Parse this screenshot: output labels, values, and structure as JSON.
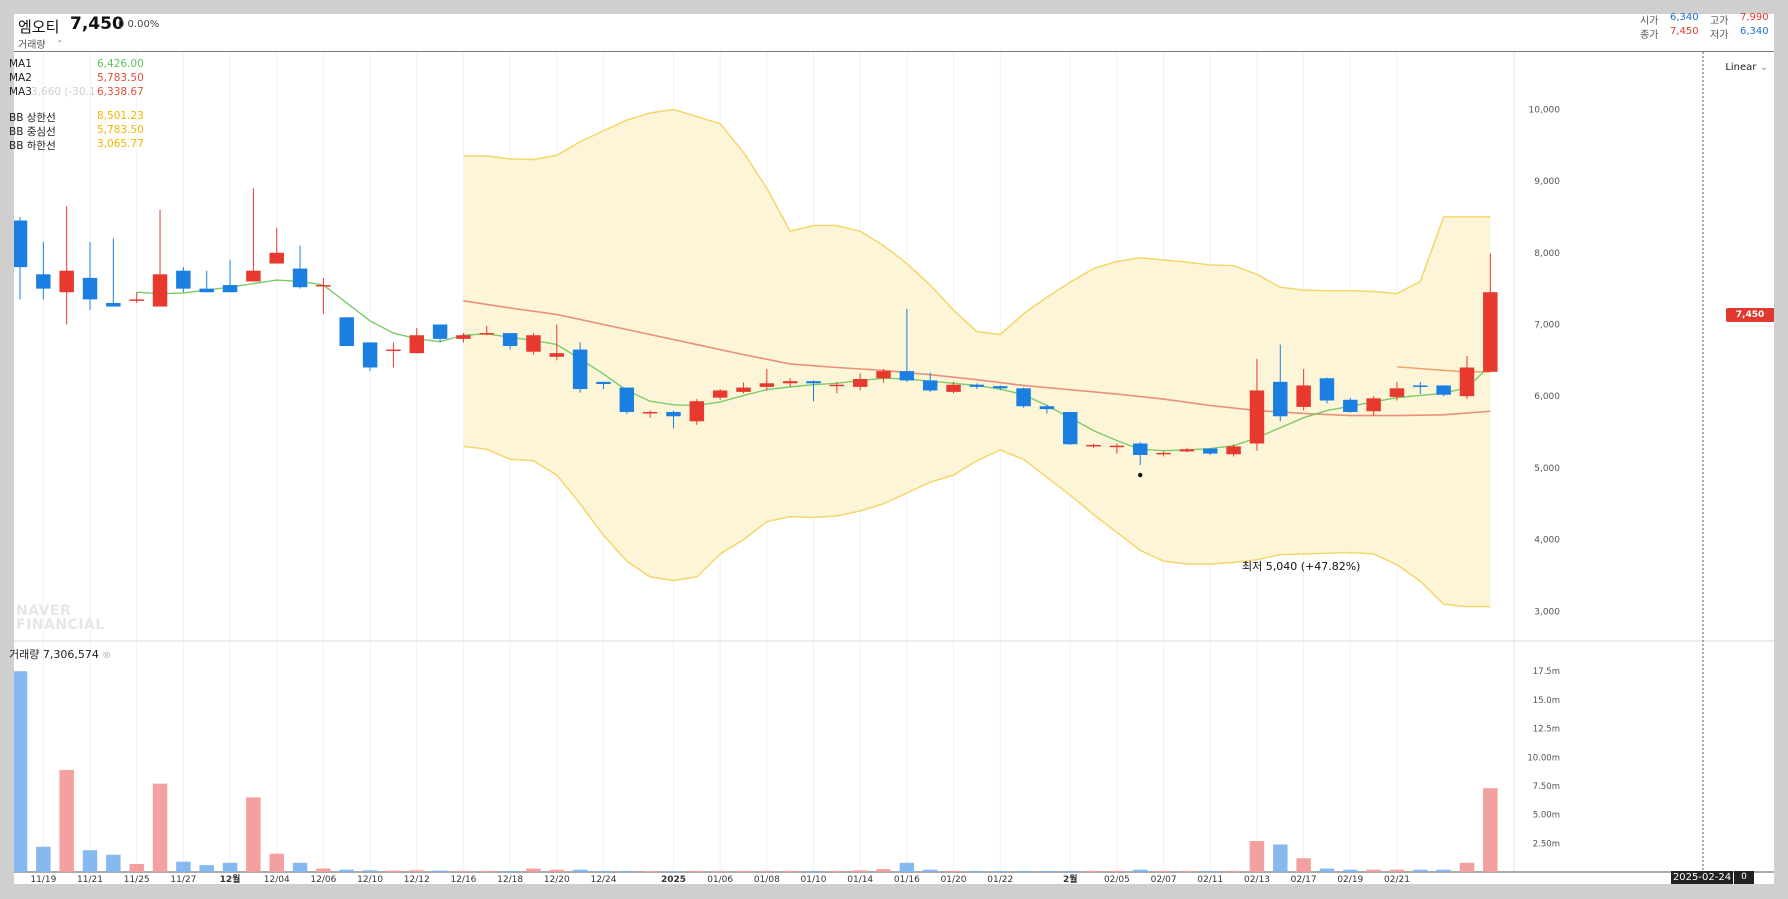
{
  "header": {
    "name": "엠오티",
    "price": "7,450",
    "change": "0 0.00%",
    "volume_label": "거래량",
    "volume_value": "-",
    "open_label": "시가",
    "open": "6,340",
    "high_label": "고가",
    "high": "7,990",
    "close_label": "종가",
    "close": "7,450",
    "low_label": "저가",
    "low": "6,340"
  },
  "legend": [
    {
      "name": "MA1",
      "value": "6,426.00",
      "color": "#5fbf5f"
    },
    {
      "name": "MA2",
      "value": "5,783.50",
      "color": "#e0503a"
    },
    {
      "name": "MA3",
      "value": "6,338.67",
      "color": "#e0503a"
    },
    {
      "name": "BB 상한선",
      "value": "8,501.23",
      "color": "#f0b400"
    },
    {
      "name": "BB 중심선",
      "value": "5,783.50",
      "color": "#f0b400"
    },
    {
      "name": "BB 하한선",
      "value": "3,065.77",
      "color": "#f0b400"
    }
  ],
  "legend_extra": "3,660 (-30.11%)",
  "scale_button": "Linear",
  "current_price_tag": "7,450",
  "volume_title": "거래량 7,306,574",
  "watermark": [
    "NAVER",
    "FINANCIAL"
  ],
  "min_label": "최저 5,040 (+47.82%)",
  "date_tag": "2025-02-24",
  "volume_tag": "0",
  "colors": {
    "up": "#e8392e",
    "down": "#1a7fe0",
    "band": "#fdf5d8",
    "band_edge": "#f5d66a"
  },
  "chart_data": {
    "type": "candlestick",
    "price_axis": [
      "10,000",
      "9,000",
      "8,000",
      "7,000",
      "6,000",
      "5,000",
      "4,000",
      "3,000"
    ],
    "price_ylim": [
      2600,
      10800
    ],
    "volume_axis": [
      "17.5m",
      "15.0m",
      "12.5m",
      "10.00m",
      "7.50m",
      "5.00m",
      "2.50m"
    ],
    "volume_ylim": [
      0,
      19000000
    ],
    "x_labels": [
      {
        "i": 1,
        "text": "11/19"
      },
      {
        "i": 3,
        "text": "11/21"
      },
      {
        "i": 5,
        "text": "11/25"
      },
      {
        "i": 7,
        "text": "11/27"
      },
      {
        "i": 9,
        "text": "12월",
        "bold": true
      },
      {
        "i": 11,
        "text": "12/04"
      },
      {
        "i": 13,
        "text": "12/06"
      },
      {
        "i": 15,
        "text": "12/10"
      },
      {
        "i": 17,
        "text": "12/12"
      },
      {
        "i": 19,
        "text": "12/16"
      },
      {
        "i": 21,
        "text": "12/18"
      },
      {
        "i": 23,
        "text": "12/20"
      },
      {
        "i": 25,
        "text": "12/24"
      },
      {
        "i": 28,
        "text": "2025",
        "bold": true
      },
      {
        "i": 30,
        "text": "01/06"
      },
      {
        "i": 32,
        "text": "01/08"
      },
      {
        "i": 34,
        "text": "01/10"
      },
      {
        "i": 36,
        "text": "01/14"
      },
      {
        "i": 38,
        "text": "01/16"
      },
      {
        "i": 40,
        "text": "01/20"
      },
      {
        "i": 42,
        "text": "01/22"
      },
      {
        "i": 45,
        "text": "2월",
        "bold": true
      },
      {
        "i": 47,
        "text": "02/05"
      },
      {
        "i": 49,
        "text": "02/07"
      },
      {
        "i": 51,
        "text": "02/11"
      },
      {
        "i": 53,
        "text": "02/13"
      },
      {
        "i": 55,
        "text": "02/17"
      },
      {
        "i": 57,
        "text": "02/19"
      },
      {
        "i": 59,
        "text": "02/21"
      }
    ],
    "candles": [
      {
        "o": 8450,
        "h": 8500,
        "l": 7350,
        "c": 7800,
        "v": 17500000
      },
      {
        "o": 7700,
        "h": 8150,
        "l": 7350,
        "c": 7500,
        "v": 2200000
      },
      {
        "o": 7450,
        "h": 8650,
        "l": 7000,
        "c": 7750,
        "v": 8900000
      },
      {
        "o": 7650,
        "h": 8150,
        "l": 7200,
        "c": 7350,
        "v": 1900000
      },
      {
        "o": 7300,
        "h": 8200,
        "l": 7250,
        "c": 7250,
        "v": 1500000
      },
      {
        "o": 7350,
        "h": 7450,
        "l": 7300,
        "c": 7350,
        "v": 700000
      },
      {
        "o": 7250,
        "h": 8600,
        "l": 7250,
        "c": 7700,
        "v": 7700000
      },
      {
        "o": 7750,
        "h": 7800,
        "l": 7450,
        "c": 7500,
        "v": 900000
      },
      {
        "o": 7500,
        "h": 7750,
        "l": 7450,
        "c": 7450,
        "v": 600000
      },
      {
        "o": 7550,
        "h": 7900,
        "l": 7450,
        "c": 7450,
        "v": 800000
      },
      {
        "o": 7600,
        "h": 8900,
        "l": 7600,
        "c": 7750,
        "v": 6500000
      },
      {
        "o": 7850,
        "h": 8350,
        "l": 7850,
        "c": 8000,
        "v": 1600000
      },
      {
        "o": 7780,
        "h": 8100,
        "l": 7500,
        "c": 7520,
        "v": 800000
      },
      {
        "o": 7550,
        "h": 7650,
        "l": 7150,
        "c": 7550,
        "v": 300000
      },
      {
        "o": 7100,
        "h": 7100,
        "l": 6700,
        "c": 6700,
        "v": 200000
      },
      {
        "o": 6750,
        "h": 6750,
        "l": 6350,
        "c": 6400,
        "v": 150000
      },
      {
        "o": 6650,
        "h": 6750,
        "l": 6400,
        "c": 6650,
        "v": 120000
      },
      {
        "o": 6600,
        "h": 6950,
        "l": 6600,
        "c": 6850,
        "v": 150000
      },
      {
        "o": 7000,
        "h": 7000,
        "l": 6750,
        "c": 6800,
        "v": 120000
      },
      {
        "o": 6800,
        "h": 6880,
        "l": 6750,
        "c": 6850,
        "v": 100000
      },
      {
        "o": 6880,
        "h": 6980,
        "l": 6850,
        "c": 6880,
        "v": 100000
      },
      {
        "o": 6880,
        "h": 6880,
        "l": 6650,
        "c": 6700,
        "v": 100000
      },
      {
        "o": 6620,
        "h": 6880,
        "l": 6580,
        "c": 6850,
        "v": 300000
      },
      {
        "o": 6550,
        "h": 7000,
        "l": 6500,
        "c": 6600,
        "v": 200000
      },
      {
        "o": 6650,
        "h": 6750,
        "l": 6050,
        "c": 6100,
        "v": 200000
      },
      {
        "o": 6200,
        "h": 6200,
        "l": 6100,
        "c": 6170,
        "v": 100000
      },
      {
        "o": 6120,
        "h": 6120,
        "l": 5750,
        "c": 5780,
        "v": 100000
      },
      {
        "o": 5780,
        "h": 5800,
        "l": 5700,
        "c": 5780,
        "v": 80000
      },
      {
        "o": 5780,
        "h": 5800,
        "l": 5550,
        "c": 5720,
        "v": 80000
      },
      {
        "o": 5650,
        "h": 5960,
        "l": 5600,
        "c": 5930,
        "v": 100000
      },
      {
        "o": 5980,
        "h": 6100,
        "l": 5950,
        "c": 6080,
        "v": 100000
      },
      {
        "o": 6060,
        "h": 6190,
        "l": 6040,
        "c": 6120,
        "v": 100000
      },
      {
        "o": 6130,
        "h": 6380,
        "l": 6080,
        "c": 6180,
        "v": 100000
      },
      {
        "o": 6180,
        "h": 6250,
        "l": 6130,
        "c": 6210,
        "v": 100000
      },
      {
        "o": 6210,
        "h": 6220,
        "l": 5930,
        "c": 6180,
        "v": 100000
      },
      {
        "o": 6140,
        "h": 6200,
        "l": 6040,
        "c": 6160,
        "v": 100000
      },
      {
        "o": 6130,
        "h": 6320,
        "l": 6080,
        "c": 6240,
        "v": 150000
      },
      {
        "o": 6250,
        "h": 6380,
        "l": 6190,
        "c": 6350,
        "v": 250000
      },
      {
        "o": 6350,
        "h": 7220,
        "l": 6200,
        "c": 6220,
        "v": 800000
      },
      {
        "o": 6220,
        "h": 6330,
        "l": 6060,
        "c": 6080,
        "v": 200000
      },
      {
        "o": 6060,
        "h": 6200,
        "l": 6040,
        "c": 6160,
        "v": 100000
      },
      {
        "o": 6160,
        "h": 6180,
        "l": 6100,
        "c": 6130,
        "v": 100000
      },
      {
        "o": 6140,
        "h": 6150,
        "l": 6080,
        "c": 6110,
        "v": 100000
      },
      {
        "o": 6110,
        "h": 6120,
        "l": 5840,
        "c": 5860,
        "v": 100000
      },
      {
        "o": 5860,
        "h": 5880,
        "l": 5760,
        "c": 5820,
        "v": 100000
      },
      {
        "o": 5780,
        "h": 5780,
        "l": 5320,
        "c": 5330,
        "v": 100000
      },
      {
        "o": 5320,
        "h": 5340,
        "l": 5280,
        "c": 5320,
        "v": 100000
      },
      {
        "o": 5290,
        "h": 5340,
        "l": 5200,
        "c": 5310,
        "v": 100000
      },
      {
        "o": 5340,
        "h": 5360,
        "l": 5040,
        "c": 5180,
        "v": 200000
      },
      {
        "o": 5200,
        "h": 5230,
        "l": 5160,
        "c": 5210,
        "v": 100000
      },
      {
        "o": 5230,
        "h": 5280,
        "l": 5220,
        "c": 5260,
        "v": 100000
      },
      {
        "o": 5270,
        "h": 5270,
        "l": 5180,
        "c": 5200,
        "v": 100000
      },
      {
        "o": 5190,
        "h": 5330,
        "l": 5160,
        "c": 5300,
        "v": 100000
      },
      {
        "o": 5340,
        "h": 6520,
        "l": 5240,
        "c": 6080,
        "v": 2700000
      },
      {
        "o": 6200,
        "h": 6720,
        "l": 5650,
        "c": 5720,
        "v": 2400000
      },
      {
        "o": 5850,
        "h": 6380,
        "l": 5800,
        "c": 6150,
        "v": 1200000
      },
      {
        "o": 6250,
        "h": 6260,
        "l": 5900,
        "c": 5940,
        "v": 300000
      },
      {
        "o": 5950,
        "h": 5980,
        "l": 5770,
        "c": 5780,
        "v": 200000
      },
      {
        "o": 5790,
        "h": 6000,
        "l": 5730,
        "c": 5970,
        "v": 200000
      },
      {
        "o": 5990,
        "h": 6200,
        "l": 5940,
        "c": 6110,
        "v": 200000
      },
      {
        "o": 6150,
        "h": 6200,
        "l": 6030,
        "c": 6130,
        "v": 200000
      },
      {
        "o": 6150,
        "h": 6150,
        "l": 6000,
        "c": 6020,
        "v": 200000
      },
      {
        "o": 6000,
        "h": 6560,
        "l": 5960,
        "c": 6400,
        "v": 800000
      },
      {
        "o": 6340,
        "h": 7990,
        "l": 6340,
        "c": 7450,
        "v": 7306574
      }
    ],
    "ma_short": [
      [
        5,
        7450
      ],
      [
        6,
        7430
      ],
      [
        7,
        7440
      ],
      [
        8,
        7480
      ],
      [
        9,
        7520
      ],
      [
        10,
        7570
      ],
      [
        11,
        7620
      ],
      [
        12,
        7600
      ],
      [
        13,
        7550
      ],
      [
        14,
        7300
      ],
      [
        15,
        7050
      ],
      [
        16,
        6880
      ],
      [
        17,
        6800
      ],
      [
        18,
        6760
      ],
      [
        19,
        6850
      ],
      [
        20,
        6870
      ],
      [
        21,
        6820
      ],
      [
        22,
        6780
      ],
      [
        23,
        6720
      ],
      [
        24,
        6520
      ],
      [
        25,
        6310
      ],
      [
        26,
        6080
      ],
      [
        27,
        5930
      ],
      [
        28,
        5880
      ],
      [
        29,
        5870
      ],
      [
        30,
        5920
      ],
      [
        31,
        6010
      ],
      [
        32,
        6090
      ],
      [
        33,
        6130
      ],
      [
        34,
        6160
      ],
      [
        35,
        6180
      ],
      [
        36,
        6220
      ],
      [
        37,
        6250
      ],
      [
        38,
        6240
      ],
      [
        39,
        6210
      ],
      [
        40,
        6180
      ],
      [
        41,
        6150
      ],
      [
        42,
        6100
      ],
      [
        43,
        6020
      ],
      [
        44,
        5870
      ],
      [
        45,
        5700
      ],
      [
        46,
        5520
      ],
      [
        47,
        5380
      ],
      [
        48,
        5260
      ],
      [
        49,
        5240
      ],
      [
        50,
        5250
      ],
      [
        51,
        5270
      ],
      [
        52,
        5310
      ],
      [
        53,
        5420
      ],
      [
        54,
        5560
      ],
      [
        55,
        5700
      ],
      [
        56,
        5800
      ],
      [
        57,
        5860
      ],
      [
        58,
        5920
      ],
      [
        59,
        5980
      ],
      [
        60,
        6010
      ],
      [
        61,
        6040
      ],
      [
        62,
        6120
      ],
      [
        63,
        6426
      ]
    ],
    "ma_mid": [
      [
        19,
        7330
      ],
      [
        21,
        7230
      ],
      [
        23,
        7140
      ],
      [
        25,
        7000
      ],
      [
        27,
        6860
      ],
      [
        29,
        6720
      ],
      [
        31,
        6580
      ],
      [
        33,
        6450
      ],
      [
        35,
        6400
      ],
      [
        37,
        6360
      ],
      [
        39,
        6300
      ],
      [
        41,
        6230
      ],
      [
        43,
        6150
      ],
      [
        45,
        6090
      ],
      [
        47,
        6030
      ],
      [
        49,
        5960
      ],
      [
        51,
        5870
      ],
      [
        53,
        5800
      ],
      [
        55,
        5760
      ],
      [
        57,
        5730
      ],
      [
        59,
        5730
      ],
      [
        61,
        5740
      ],
      [
        63,
        5790
      ]
    ],
    "ma_long": [
      [
        59,
        6410
      ],
      [
        61,
        6360
      ],
      [
        62,
        6340
      ],
      [
        63,
        6339
      ]
    ],
    "bb_upper": [
      [
        19,
        9350
      ],
      [
        20,
        9350
      ],
      [
        21,
        9310
      ],
      [
        22,
        9300
      ],
      [
        23,
        9360
      ],
      [
        24,
        9550
      ],
      [
        25,
        9700
      ],
      [
        26,
        9850
      ],
      [
        27,
        9950
      ],
      [
        28,
        10000
      ],
      [
        29,
        9900
      ],
      [
        30,
        9800
      ],
      [
        31,
        9400
      ],
      [
        32,
        8900
      ],
      [
        33,
        8300
      ],
      [
        34,
        8380
      ],
      [
        35,
        8380
      ],
      [
        36,
        8300
      ],
      [
        37,
        8100
      ],
      [
        38,
        7850
      ],
      [
        39,
        7550
      ],
      [
        40,
        7200
      ],
      [
        41,
        6900
      ],
      [
        42,
        6860
      ],
      [
        43,
        7150
      ],
      [
        44,
        7380
      ],
      [
        45,
        7590
      ],
      [
        46,
        7780
      ],
      [
        47,
        7880
      ],
      [
        48,
        7930
      ],
      [
        49,
        7900
      ],
      [
        50,
        7870
      ],
      [
        51,
        7830
      ],
      [
        52,
        7820
      ],
      [
        53,
        7700
      ],
      [
        54,
        7520
      ],
      [
        55,
        7480
      ],
      [
        56,
        7470
      ],
      [
        57,
        7470
      ],
      [
        58,
        7460
      ],
      [
        59,
        7430
      ],
      [
        60,
        7600
      ],
      [
        61,
        8500
      ],
      [
        62,
        8500
      ],
      [
        63,
        8501
      ]
    ],
    "bb_lower": [
      [
        19,
        5300
      ],
      [
        20,
        5260
      ],
      [
        21,
        5120
      ],
      [
        22,
        5100
      ],
      [
        23,
        4900
      ],
      [
        24,
        4500
      ],
      [
        25,
        4060
      ],
      [
        26,
        3700
      ],
      [
        27,
        3480
      ],
      [
        28,
        3430
      ],
      [
        29,
        3480
      ],
      [
        30,
        3800
      ],
      [
        31,
        4000
      ],
      [
        32,
        4250
      ],
      [
        33,
        4320
      ],
      [
        34,
        4310
      ],
      [
        35,
        4330
      ],
      [
        36,
        4400
      ],
      [
        37,
        4500
      ],
      [
        38,
        4650
      ],
      [
        39,
        4800
      ],
      [
        40,
        4900
      ],
      [
        41,
        5100
      ],
      [
        42,
        5250
      ],
      [
        43,
        5120
      ],
      [
        44,
        4870
      ],
      [
        45,
        4620
      ],
      [
        46,
        4350
      ],
      [
        47,
        4100
      ],
      [
        48,
        3850
      ],
      [
        49,
        3700
      ],
      [
        50,
        3660
      ],
      [
        51,
        3660
      ],
      [
        52,
        3680
      ],
      [
        53,
        3720
      ],
      [
        54,
        3790
      ],
      [
        55,
        3800
      ],
      [
        56,
        3810
      ],
      [
        57,
        3820
      ],
      [
        58,
        3800
      ],
      [
        59,
        3650
      ],
      [
        60,
        3420
      ],
      [
        61,
        3100
      ],
      [
        62,
        3066
      ],
      [
        63,
        3066
      ]
    ]
  }
}
